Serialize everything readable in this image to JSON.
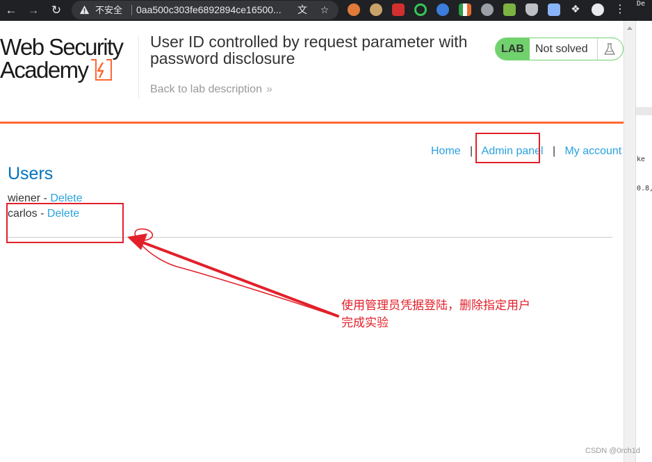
{
  "browser": {
    "security_label": "不安全",
    "url": "0aa500c303fe6892894ce16500...",
    "icons": [
      "back-icon",
      "forward-icon",
      "reload-icon",
      "warning-icon",
      "translate-icon",
      "bookmark-star-icon",
      "profile-icon",
      "menu-dots-icon"
    ]
  },
  "lab": {
    "logo_line1": "Web Security",
    "logo_line2": "Academy",
    "title": "User ID controlled by request parameter with password disclosure",
    "back_link": "Back to lab description",
    "back_chevron": "»",
    "badge": "LAB",
    "status": "Not solved",
    "accent": "#ff6633",
    "status_color": "#70d16d"
  },
  "nav": {
    "home": "Home",
    "separator": "|",
    "admin_panel": "Admin panel",
    "my_account": "My account"
  },
  "page": {
    "title": "Users",
    "users": [
      {
        "name": "wiener",
        "dash": " - ",
        "action": "Delete"
      },
      {
        "name": "carlos",
        "dash": " - ",
        "action": "Delete"
      }
    ]
  },
  "annotation": {
    "line1": "使用管理员凭据登陆，删除指定用户",
    "line2": "完成实验",
    "color": "#e2202a"
  },
  "side_panel": {
    "lines": [
      "De",
      "ke",
      "0.8,"
    ]
  },
  "watermark": "CSDN @0rch1d"
}
